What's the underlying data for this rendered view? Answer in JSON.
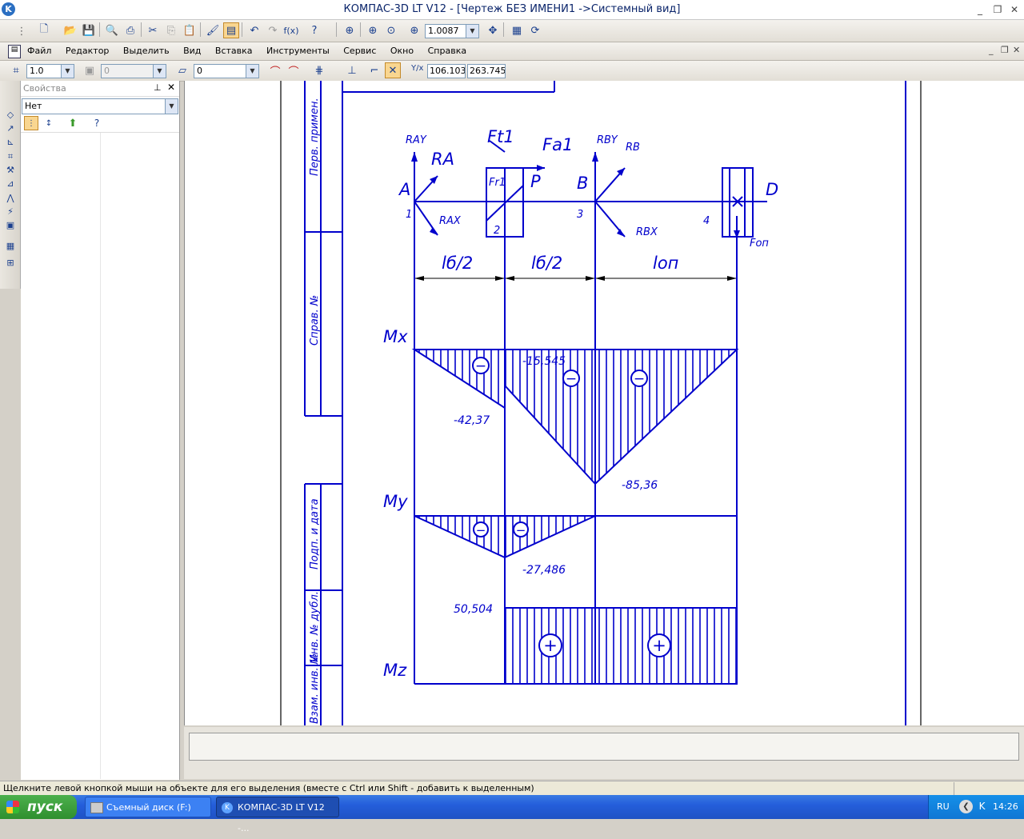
{
  "window": {
    "title": "КОМПАС-3D LT V12 - [Чертеж БЕЗ ИМЕНИ1 ->Системный вид]"
  },
  "toolbar": {
    "zoom_value": "1.0087"
  },
  "menu": {
    "items": [
      "Файл",
      "Редактор",
      "Выделить",
      "Вид",
      "Вставка",
      "Инструменты",
      "Сервис",
      "Окно",
      "Справка"
    ]
  },
  "toolbar2": {
    "scale_value": "1.0",
    "layer_disabled_value": "0",
    "style_value": "0",
    "coord_x": "106.103",
    "coord_y": "263.745"
  },
  "props": {
    "title": "Свойства",
    "filter_value": "Нет"
  },
  "stamp": {
    "first_use": "Перв. примен.",
    "ref_no": "Справ. №",
    "sign_date": "Подп. и дата",
    "dup_no": "Инв. № дубл.",
    "inv_no": "Взам. инв. №"
  },
  "drawing": {
    "labels": {
      "RAY": "RAY",
      "RA": "RA",
      "A": "A",
      "one": "1",
      "RAX": "RAX",
      "Ft1": "Ft1",
      "Fr1": "Fr1",
      "two": "2",
      "Fa1": "Fa1",
      "P": "P",
      "RBY": "RBY",
      "RB": "RB",
      "B": "B",
      "three": "3",
      "RBX": "RBX",
      "four": "4",
      "D": "D",
      "Fon": "Fоп",
      "dim1": "lб/2",
      "dim2": "lб/2",
      "dim3": "lоп",
      "Mx": "Mx",
      "My": "My",
      "Mz": "Mz"
    },
    "values": {
      "mx_a": "-42,37",
      "mx_b": "-15,545",
      "mx_c": "-85,36",
      "my_a": "-27,486",
      "mz_a": "50,504"
    },
    "signs": {
      "minus": "−",
      "plus": "+"
    }
  },
  "statusbar": {
    "hint": "Щелкните левой кнопкой мыши на объекте для его выделения (вместе с Ctrl или Shift - добавить к выделенным)"
  },
  "taskbar": {
    "start_label": "пуск",
    "task1": "Съемный диск (F:)",
    "task2": "КОМПАС-3D LT V12 -...",
    "lang": "RU",
    "clock": "14:26"
  }
}
